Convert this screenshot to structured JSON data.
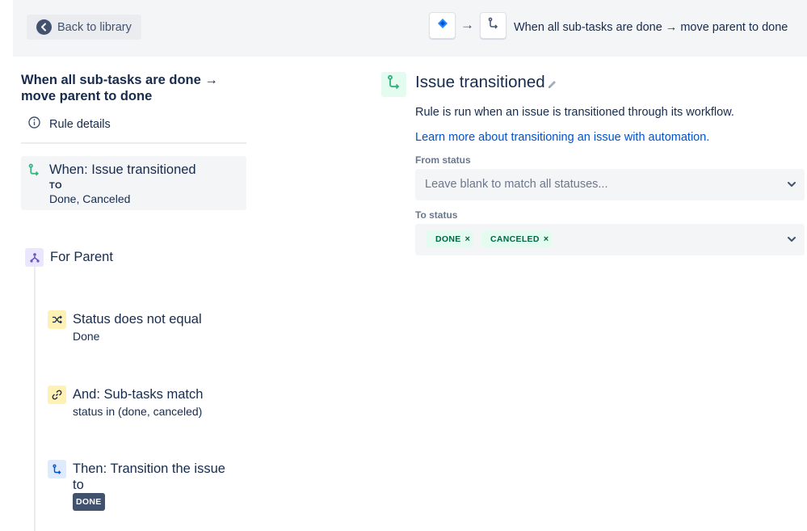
{
  "header": {
    "back_label": "Back to library",
    "title": "When all sub-tasks are done → move parent to done",
    "arrow": "→"
  },
  "sidebar": {
    "rule_title": "When all sub-tasks are done → move parent to done",
    "rule_details_label": "Rule details",
    "trigger": {
      "title": "When: Issue transitioned",
      "to_label": "TO",
      "statuses": "Done, Canceled"
    },
    "branch": {
      "label": "For Parent"
    },
    "steps": [
      {
        "title": "Status does not equal",
        "detail": "Done"
      },
      {
        "title": "And: Sub-tasks match",
        "detail": "status in (done, canceled)"
      },
      {
        "title": "Then: Transition the issue",
        "title_line2": "to",
        "badge": "DONE"
      }
    ]
  },
  "main": {
    "title": "Issue transitioned",
    "description": "Rule is run when an issue is transitioned through its workflow.",
    "learn_link": "Learn more about transitioning an issue with automation.",
    "from_status": {
      "label": "From status",
      "placeholder": "Leave blank to match all statuses..."
    },
    "to_status": {
      "label": "To status",
      "tags": [
        {
          "label": "DONE",
          "remove": "×"
        },
        {
          "label": "CANCELED",
          "remove": "×"
        }
      ]
    }
  },
  "icons": {
    "back": "arrow-left-icon",
    "jira": "jira-diamond-icon",
    "transition": "transition-icon",
    "info": "info-icon",
    "branch": "branch-icon",
    "shuffle": "condition-icon",
    "link": "link-icon",
    "edit": "pencil-icon",
    "chevron": "chevron-down-icon"
  },
  "colors": {
    "link": "#0052cc",
    "text": "#172b4d",
    "transition_green": "#36b37e",
    "branch_purple": "#6554c0",
    "condition_yellow": "#fff0b3",
    "tag_green_bg": "#e3fcef",
    "tag_green_text": "#006644"
  }
}
